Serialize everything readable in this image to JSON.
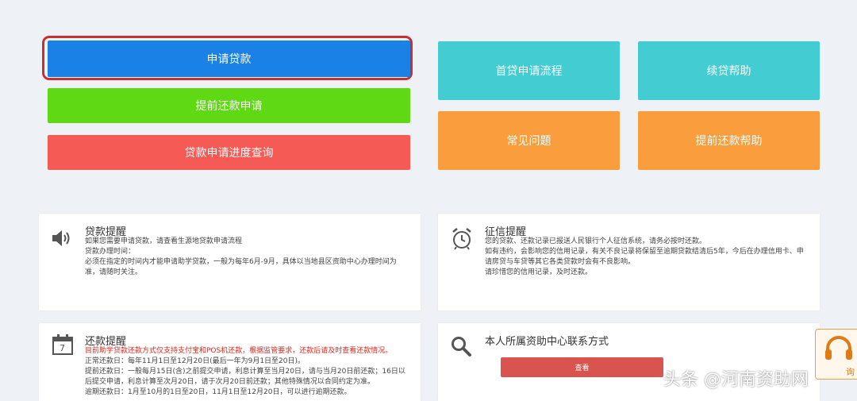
{
  "buttons": {
    "apply_loan": "申请贷款",
    "early_repay_apply": "提前还款申请",
    "progress_query": "贷款申请进度查询",
    "first_loan_process": "首贷申请流程",
    "renew_help": "续贷帮助",
    "faq": "常见问题",
    "early_repay_help": "提前还款帮助"
  },
  "loan_reminder": {
    "title": "贷款提醒",
    "lines": [
      "如果您需要申请贷款，请查看生源地贷款申请流程",
      "贷款办理时间：",
      "必须在指定的时间内才能申请助学贷款，一般为每年6月-9月，具体以当地县区资助中心办理时间为",
      "准，请随时关注。"
    ]
  },
  "credit_reminder": {
    "title": "征信提醒",
    "lines": [
      "您的贷款、还款记录已报送人民银行个人征信系统，请务必按时还款。",
      "如有违约，会影响您的信用记录，有关不良记录将保留至逾期贷款结清后5年，今后在办理信用卡、申",
      "请房贷与车贷等其它各类贷款时会有不良影响。",
      "请珍惜您的信用记录，及时还款。"
    ]
  },
  "repay_reminder": {
    "title": "还款提醒",
    "calendar_number": "7",
    "notice": "目前助学贷款还款方式仅支持支付宝和POS机还款，根据监管要求，还款后请及时查看还款情况。",
    "lines": [
      "正常还款日：每年11月1日至12月20日(最后一年为9月1日至20日)。",
      "提前还款日：一般每月15日(含)之前提交申请，利息计算至当月20日，请与当月20日前还款；16日以",
      "后提交申请，利息计算至次月20日，请于次月20日前还款；其他特殊情况以合同约定为准。",
      "逾期还款日：1月至10月的1日至20日，11月1日至12月20日，可以进行逾期还款。"
    ]
  },
  "contact": {
    "title": "本人所属资助中心联系方式",
    "view_label": "查看"
  },
  "side_widget": {
    "label": "询"
  },
  "watermark": "头条 @河南资助网",
  "colors": {
    "blue": "#1a82e7",
    "green": "#5fd913",
    "red": "#f55a55",
    "teal": "#43cdd3",
    "orange": "#fa9d3c"
  },
  "icons": [
    "speaker-icon",
    "alarm-clock-icon",
    "calendar-icon",
    "search-icon",
    "headset-icon"
  ]
}
